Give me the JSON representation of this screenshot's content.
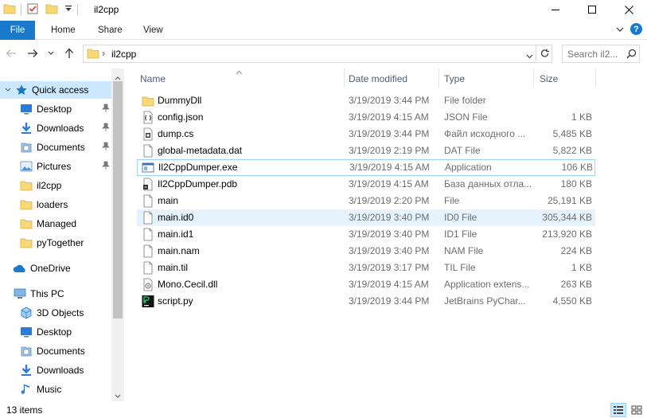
{
  "window": {
    "title": "il2cpp"
  },
  "ribbon": {
    "tabs": [
      {
        "label": "File"
      },
      {
        "label": "Home"
      },
      {
        "label": "Share"
      },
      {
        "label": "View"
      }
    ],
    "help_label": "?"
  },
  "address": {
    "separator": "›",
    "path": "il2cpp"
  },
  "search": {
    "placeholder": "Search il2..."
  },
  "nav": {
    "quick_access": "Quick access",
    "quick_items": [
      {
        "label": "Desktop",
        "pinned": true
      },
      {
        "label": "Downloads",
        "pinned": true
      },
      {
        "label": "Documents",
        "pinned": true
      },
      {
        "label": "Pictures",
        "pinned": true
      },
      {
        "label": "il2cpp",
        "pinned": false
      },
      {
        "label": "loaders",
        "pinned": false
      },
      {
        "label": "Managed",
        "pinned": false
      },
      {
        "label": "pyTogether",
        "pinned": false
      }
    ],
    "onedrive": "OneDrive",
    "this_pc": "This PC",
    "pc_items": [
      {
        "label": "3D Objects",
        "icon": "3d-objects-icon"
      },
      {
        "label": "Desktop",
        "icon": "desktop-icon"
      },
      {
        "label": "Documents",
        "icon": "documents-icon"
      },
      {
        "label": "Downloads",
        "icon": "downloads-icon"
      },
      {
        "label": "Music",
        "icon": "music-icon"
      }
    ]
  },
  "columns": {
    "name": "Name",
    "date": "Date modified",
    "type": "Type",
    "size": "Size"
  },
  "files": [
    {
      "name": "DummyDll",
      "date": "3/19/2019 3:44 PM",
      "type": "File folder",
      "size": "",
      "icon": "folder-icon"
    },
    {
      "name": "config.json",
      "date": "3/19/2019 4:15 AM",
      "type": "JSON File",
      "size": "1 KB",
      "icon": "json-file-icon"
    },
    {
      "name": "dump.cs",
      "date": "3/19/2019 3:44 PM",
      "type": "Файл исходного ...",
      "size": "5,485 KB",
      "icon": "source-file-icon"
    },
    {
      "name": "global-metadata.dat",
      "date": "3/19/2019 2:19 PM",
      "type": "DAT File",
      "size": "5,822 KB",
      "icon": "file-icon"
    },
    {
      "name": "Il2CppDumper.exe",
      "date": "3/19/2019 4:15 AM",
      "type": "Application",
      "size": "106 KB",
      "icon": "exe-icon"
    },
    {
      "name": "Il2CppDumper.pdb",
      "date": "3/19/2019 4:15 AM",
      "type": "База данных отла...",
      "size": "180 KB",
      "icon": "pdb-icon"
    },
    {
      "name": "main",
      "date": "3/19/2019 2:20 PM",
      "type": "File",
      "size": "25,191 KB",
      "icon": "file-icon"
    },
    {
      "name": "main.id0",
      "date": "3/19/2019 3:40 PM",
      "type": "ID0 File",
      "size": "305,344 KB",
      "icon": "file-icon"
    },
    {
      "name": "main.id1",
      "date": "3/19/2019 3:40 PM",
      "type": "ID1 File",
      "size": "213,920 KB",
      "icon": "file-icon"
    },
    {
      "name": "main.nam",
      "date": "3/19/2019 3:40 PM",
      "type": "NAM File",
      "size": "224 KB",
      "icon": "file-icon"
    },
    {
      "name": "main.til",
      "date": "3/19/2019 3:17 PM",
      "type": "TIL File",
      "size": "1 KB",
      "icon": "file-icon"
    },
    {
      "name": "Mono.Cecil.dll",
      "date": "3/19/2019 4:15 AM",
      "type": "Application extens...",
      "size": "263 KB",
      "icon": "dll-icon"
    },
    {
      "name": "script.py",
      "date": "3/19/2019 3:44 PM",
      "type": "JetBrains PyChar...",
      "size": "4,550 KB",
      "icon": "pycharm-icon"
    }
  ],
  "status": {
    "items_count": "13 items"
  },
  "colors": {
    "accent": "#1979ca",
    "selection": "#cce8ff",
    "hover": "#e5f3ff",
    "focus_border": "#99d1ff",
    "folder": "#f8d775",
    "header_text": "#4c607a"
  }
}
